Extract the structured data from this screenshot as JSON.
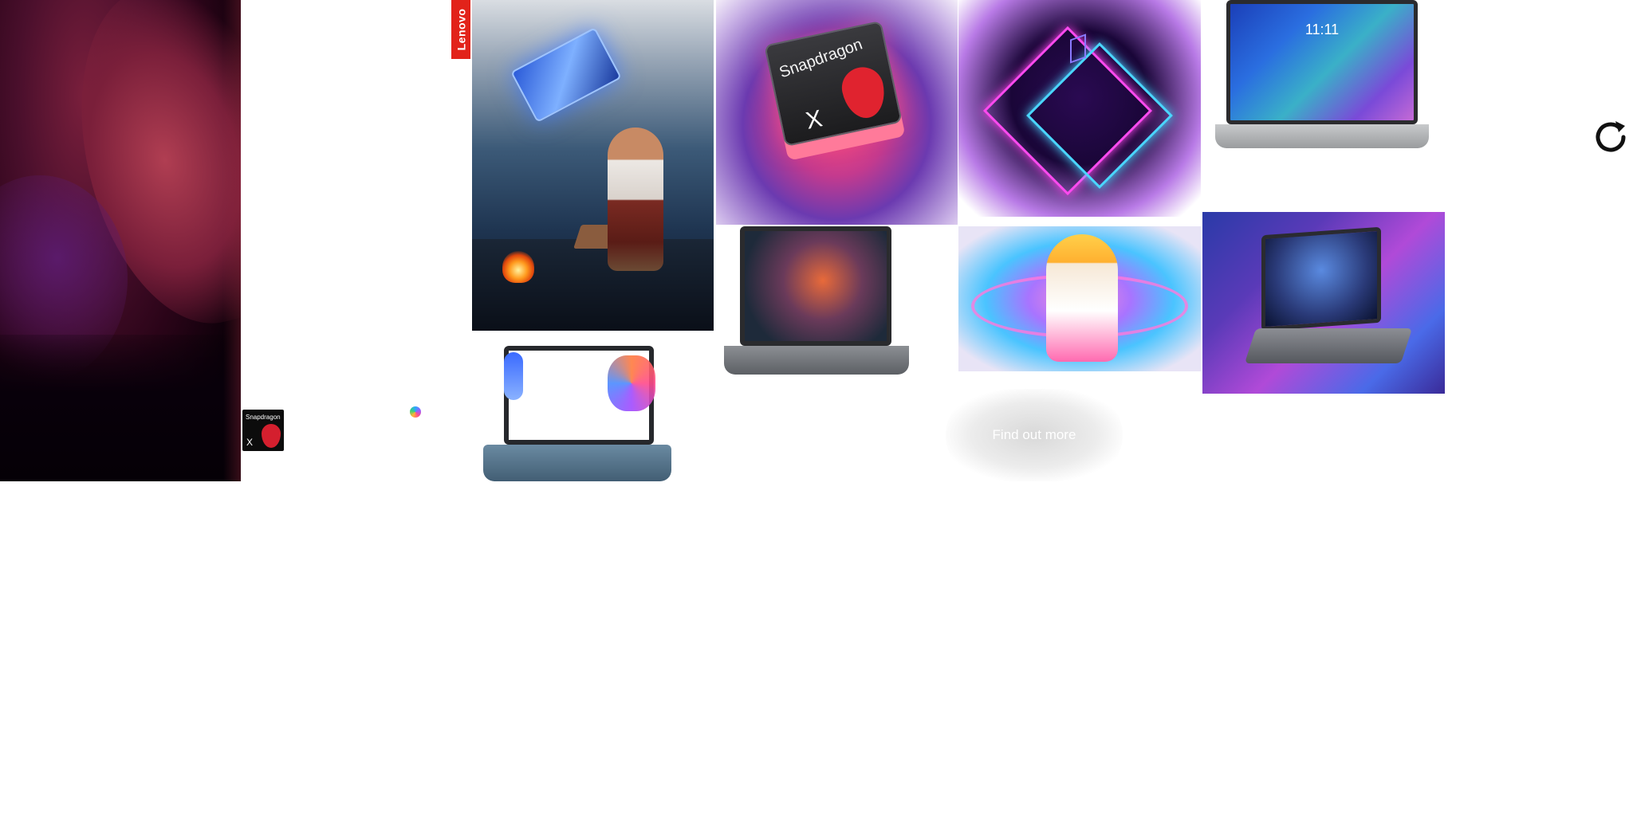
{
  "brand": {
    "logo_text": "Lenovo"
  },
  "badge": {
    "brand_text": "Snapdragon",
    "mark": "X"
  },
  "tiles": {
    "snapdragon_chip": {
      "brand_text": "Snapdragon",
      "mark": "X"
    },
    "laptop_top": {
      "clock": "11:11"
    }
  },
  "cta": {
    "label": "Find out more"
  },
  "icons": {
    "refresh": "refresh-icon",
    "copilot": "copilot-icon",
    "snapdragon": "snapdragon-logo"
  },
  "colors": {
    "lenovo_red": "#e2231a",
    "snapdragon_red": "#e0232f",
    "hero_background": "#2a0418"
  }
}
